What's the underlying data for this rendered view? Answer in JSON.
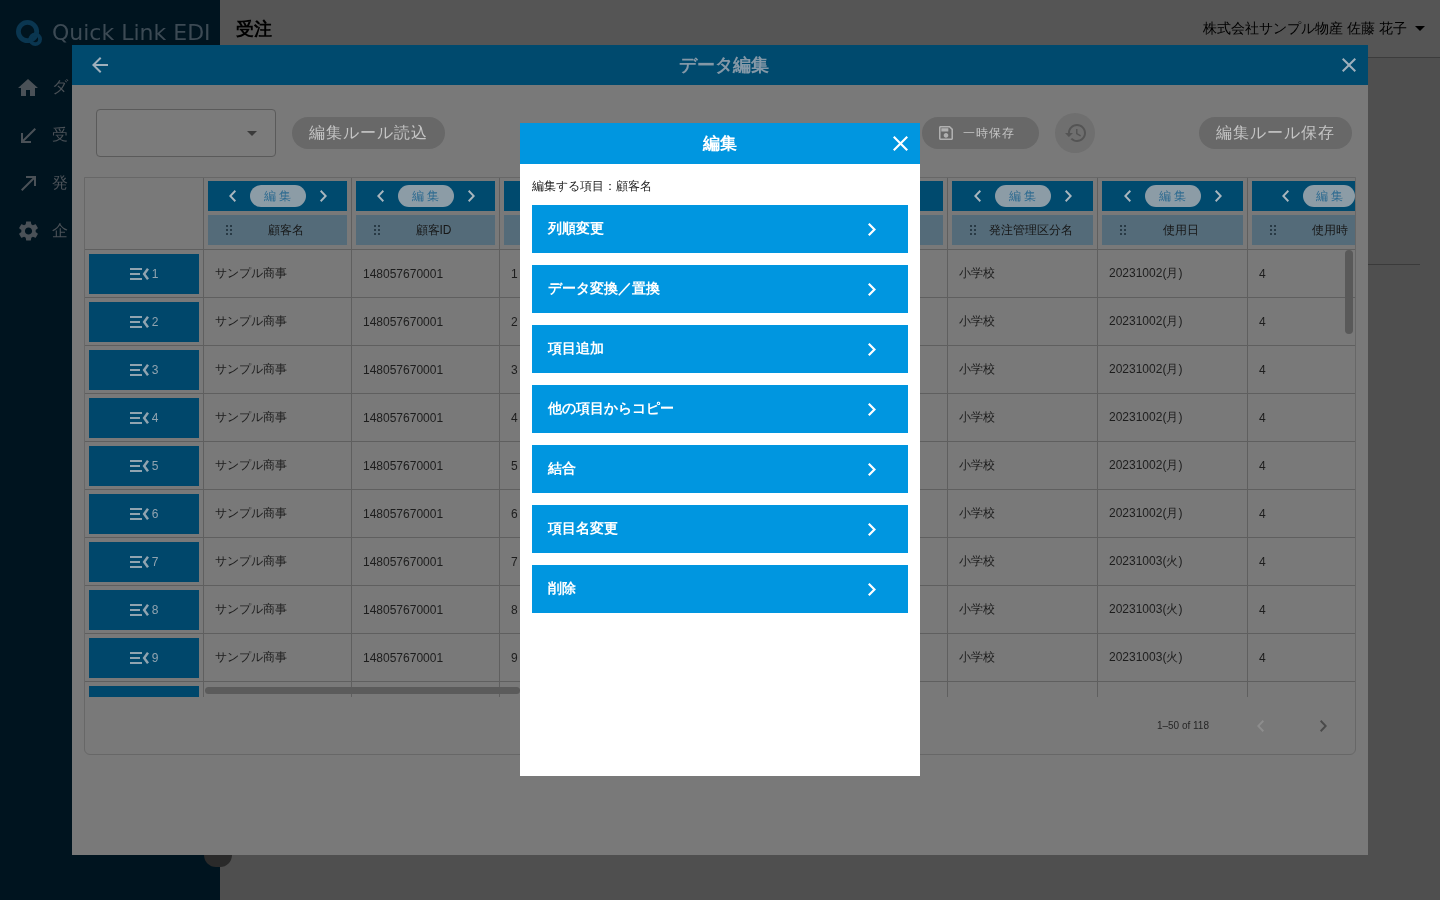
{
  "sidebar": {
    "logo": "Quick Link EDI",
    "items": [
      {
        "label": "ダ"
      },
      {
        "label": "受"
      },
      {
        "label": "発"
      },
      {
        "label": "企"
      }
    ]
  },
  "header": {
    "title": "受注",
    "user": "株式会社サンプル物産 佐藤 花子"
  },
  "dialog": {
    "title": "データ編集",
    "toolbar": {
      "buttons": [
        {
          "kind": "text",
          "label": "編集ルール読込",
          "disabled": true
        },
        {
          "kind": "save",
          "label": "一時保存",
          "disabled": true
        },
        {
          "kind": "history"
        },
        {
          "kind": "text",
          "label": "編集ルール保存",
          "disabled": true
        }
      ]
    },
    "table": {
      "columns": [
        {
          "kind": "full",
          "edit_button": "編集",
          "label": "顧客名"
        },
        {
          "kind": "full",
          "edit_button": "編集",
          "label": "顧客ID"
        },
        {
          "kind": "cut"
        },
        {
          "kind": "hidden"
        },
        {
          "kind": "covered"
        },
        {
          "kind": "full",
          "edit_button": "編集",
          "label": "発注管理区分名"
        },
        {
          "kind": "full",
          "edit_button": "編集",
          "label": "使用日"
        },
        {
          "kind": "edge",
          "edit_button": "編集",
          "label": "使用時"
        }
      ],
      "rows": [
        {
          "number": "1",
          "cells": [
            "サンプル商事",
            "148057670001",
            "1",
            "小学校",
            "20231002(月)",
            "4"
          ]
        },
        {
          "number": "2",
          "cells": [
            "サンプル商事",
            "148057670001",
            "2",
            "小学校",
            "20231002(月)",
            "4"
          ]
        },
        {
          "number": "3",
          "cells": [
            "サンプル商事",
            "148057670001",
            "3",
            "小学校",
            "20231002(月)",
            "4"
          ]
        },
        {
          "number": "4",
          "cells": [
            "サンプル商事",
            "148057670001",
            "4",
            "小学校",
            "20231002(月)",
            "4"
          ]
        },
        {
          "number": "5",
          "cells": [
            "サンプル商事",
            "148057670001",
            "5",
            "小学校",
            "20231002(月)",
            "4"
          ]
        },
        {
          "number": "6",
          "cells": [
            "サンプル商事",
            "148057670001",
            "6",
            "小学校",
            "20231002(月)",
            "4"
          ]
        },
        {
          "number": "7",
          "cells": [
            "サンプル商事",
            "148057670001",
            "7",
            "小学校",
            "20231003(火)",
            "4"
          ]
        },
        {
          "number": "8",
          "cells": [
            "サンプル商事",
            "148057670001",
            "8",
            "小学校",
            "20231003(火)",
            "4"
          ]
        },
        {
          "number": "9",
          "cells": [
            "サンプル商事",
            "148057670001",
            "9",
            "小学校",
            "20231003(火)",
            "4"
          ]
        }
      ],
      "more_rows_below": true
    },
    "pagination": {
      "range": "1–50 of 118",
      "previous": {
        "disabled": true
      },
      "next": {
        "disabled": false
      }
    }
  },
  "modal": {
    "title": "編集",
    "subject": "編集する項目：顧客名",
    "items": [
      {
        "label": "列順変更"
      },
      {
        "label": "データ変換／置換"
      },
      {
        "label": "項目追加"
      },
      {
        "label": "他の項目からコピー"
      },
      {
        "label": "結合"
      },
      {
        "label": "項目名変更"
      },
      {
        "label": "削除"
      }
    ]
  }
}
